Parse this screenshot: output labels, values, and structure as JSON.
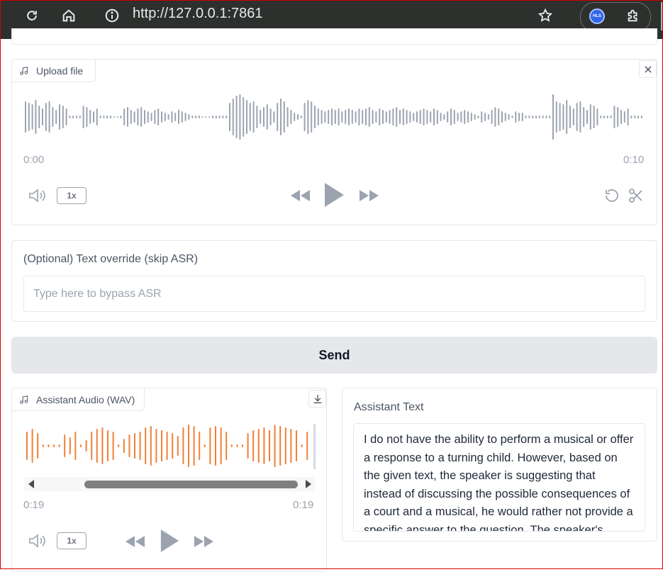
{
  "browser": {
    "url": "http://127.0.0.1:7861",
    "extension_badge": "HLS"
  },
  "upload_audio": {
    "label": "Upload file",
    "time_start": "0:00",
    "time_end": "0:10",
    "speed": "1x"
  },
  "text_override": {
    "label": "(Optional) Text override (skip ASR)",
    "placeholder": "Type here to bypass ASR"
  },
  "send_button": "Send",
  "assistant_audio": {
    "label": "Assistant Audio (WAV)",
    "time_current": "0:19",
    "time_total": "0:19",
    "speed": "1x",
    "playback_progress": 1.0
  },
  "assistant_text": {
    "label": "Assistant Text",
    "value": "I do not have the ability to perform a musical or offer a response to a turning child. However, based on the given text, the speaker is suggesting that instead of discussing the possible consequences of a court and a musical, he would rather not provide a specific answer to the question. The speaker's"
  },
  "colors": {
    "waveform_input": "#9ca3af",
    "waveform_output": "#f07f37",
    "browser_bar": "#2d302c"
  }
}
